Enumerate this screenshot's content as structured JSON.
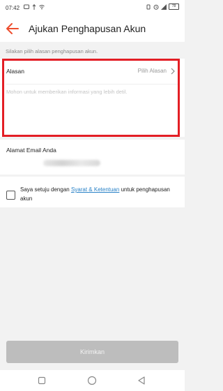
{
  "status_bar": {
    "time": "07:42",
    "battery": "78"
  },
  "header": {
    "title": "Ajukan Penghapusan Akun",
    "back_icon": "arrow-left-icon",
    "accent_color": "#ee4d2d"
  },
  "hint": "Silakan pilih alasan penghapusan akun.",
  "reason": {
    "label": "Alasan",
    "value": "Pilih Alasan",
    "textarea_placeholder": "Mohon untuk memberikan informasi yang lebih detil."
  },
  "email": {
    "label": "Alamat Email Anda"
  },
  "consent": {
    "prefix": "Saya setuju dengan ",
    "link": "Syarat & Ketentuan",
    "suffix": " untuk penghapusan akun",
    "checked": false
  },
  "submit": {
    "label": "Kirimkan",
    "enabled": false
  },
  "colors": {
    "highlight": "#e31e25",
    "link": "#2a82c7",
    "disabled_button": "#bdbdbd"
  }
}
